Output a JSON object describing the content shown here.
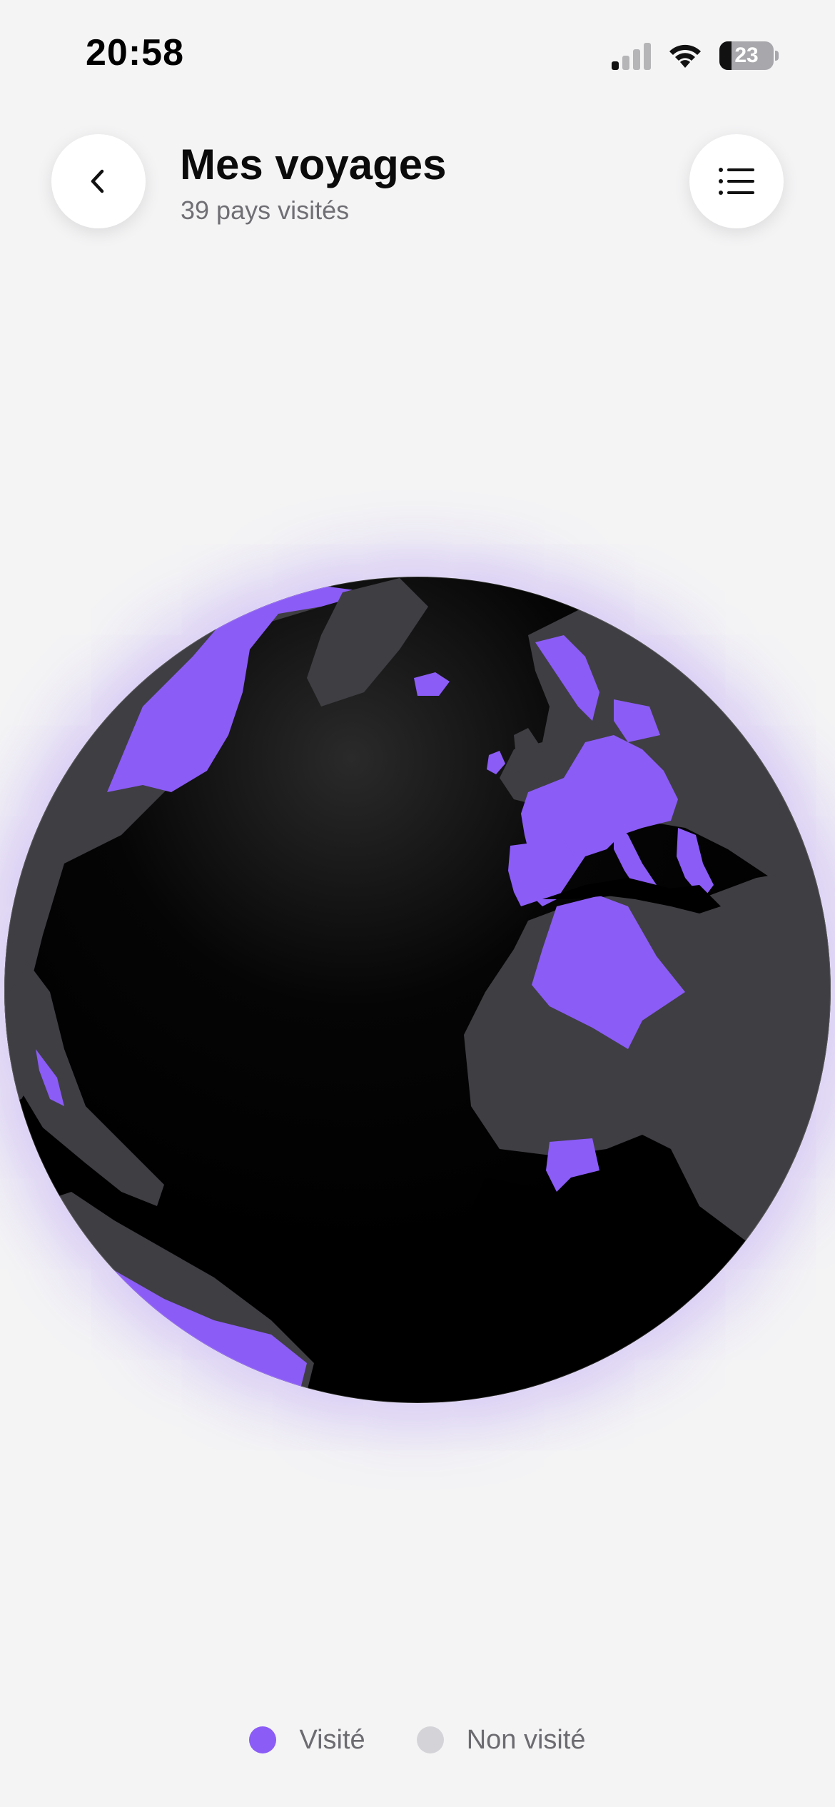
{
  "status_bar": {
    "time": "20:58",
    "battery_level": "23",
    "battery_fraction": 0.23,
    "icons": [
      "cellular-signal-icon",
      "wifi-icon",
      "battery-icon"
    ]
  },
  "header": {
    "title": "Mes voyages",
    "subtitle": "39 pays visités",
    "back_icon": "chevron-left-icon",
    "list_icon": "list-icon"
  },
  "globe": {
    "visited_color": "#8b5cf6",
    "unvisited_land_color": "#3f3e43",
    "ocean_color": "#000000",
    "glow_color": "#8b5cf6"
  },
  "legend": {
    "visited_label": "Visité",
    "visited_color": "#8b5cf6",
    "not_visited_label": "Non visité",
    "not_visited_color": "#d4d4d8"
  }
}
